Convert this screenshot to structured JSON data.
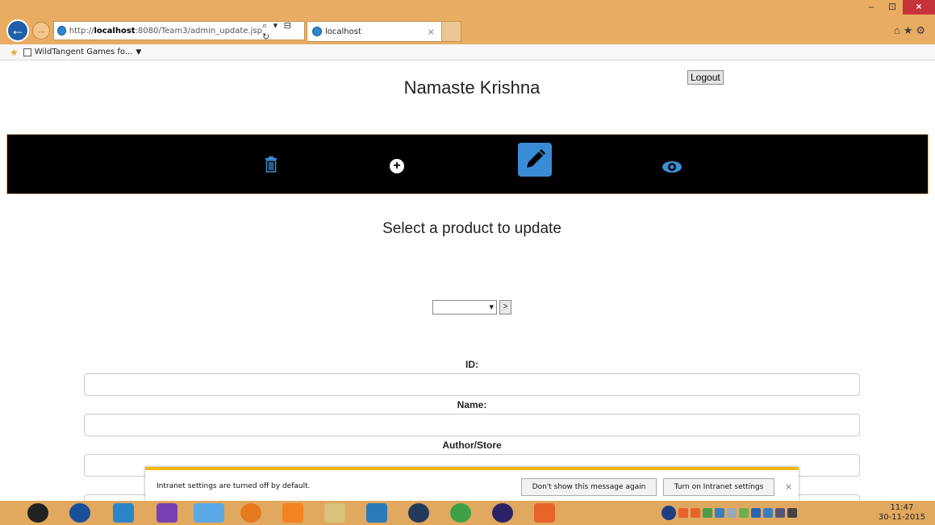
{
  "browser": {
    "url_prefix": "http://",
    "url_host": "localhost",
    "url_rest": ":8080/Team3/admin_update.jsp",
    "url_controls": "⌕ ▾ ⊟ ↻",
    "tab_title": "localhost",
    "tab_close": "×",
    "favorite_label": "WildTangent Games fo...",
    "win_minimize": "–",
    "win_restore": "⊡",
    "win_close": "×"
  },
  "header": {
    "logout_label": "Logout",
    "greeting": "Namaste Krishna"
  },
  "nav": {
    "items": [
      {
        "name": "delete",
        "icon": "trash-icon"
      },
      {
        "name": "add",
        "icon": "plus-circle-icon"
      },
      {
        "name": "update",
        "icon": "pencil-icon",
        "active": true
      },
      {
        "name": "view",
        "icon": "eye-icon"
      }
    ],
    "accent": "#3a8bd6"
  },
  "main": {
    "subtitle": "Select a product to update",
    "product_select_value": "",
    "go_label": ">",
    "fields": [
      {
        "label": "ID:",
        "value": ""
      },
      {
        "label": "Name:",
        "value": ""
      },
      {
        "label": "Author/Store",
        "value": ""
      }
    ]
  },
  "notification": {
    "message": "Intranet settings are turned off by default.",
    "dont_show_label": "Don't show this message again",
    "turn_on_label": "Turn on Intranet settings",
    "close_label": "×"
  },
  "taskbar": {
    "time": "11:47",
    "date": "30-11-2015"
  }
}
